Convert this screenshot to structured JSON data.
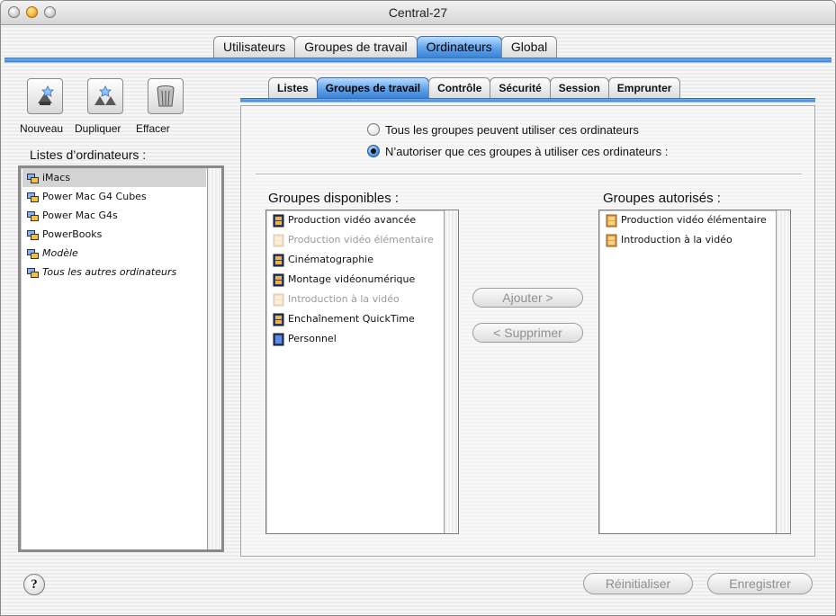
{
  "window": {
    "title": "Central-27"
  },
  "main_tabs": [
    {
      "label": "Utilisateurs",
      "active": false
    },
    {
      "label": "Groupes de travail",
      "active": false
    },
    {
      "label": "Ordinateurs",
      "active": true
    },
    {
      "label": "Global",
      "active": false
    }
  ],
  "toolbar": {
    "new_label": "Nouveau",
    "duplicate_label": "Dupliquer",
    "delete_label": "Effacer"
  },
  "computer_lists": {
    "label": "Listes d’ordinateurs :",
    "items": [
      {
        "label": "iMacs",
        "selected": true,
        "italic": false
      },
      {
        "label": "Power Mac G4 Cubes",
        "selected": false,
        "italic": false
      },
      {
        "label": "Power Mac G4s",
        "selected": false,
        "italic": false
      },
      {
        "label": "PowerBooks",
        "selected": false,
        "italic": false
      },
      {
        "label": "Modèle",
        "selected": false,
        "italic": true
      },
      {
        "label": "Tous les autres ordinateurs",
        "selected": false,
        "italic": true
      }
    ]
  },
  "sub_tabs": [
    {
      "label": "Listes",
      "active": false
    },
    {
      "label": "Groupes de travail",
      "active": true
    },
    {
      "label": "Contrôle",
      "active": false
    },
    {
      "label": "Sécurité",
      "active": false
    },
    {
      "label": "Session",
      "active": false
    },
    {
      "label": "Emprunter",
      "active": false
    }
  ],
  "options": {
    "all_groups_label": "Tous les groupes peuvent utiliser ces ordinateurs",
    "only_these_label": "N’autoriser que ces groupes à utiliser ces ordinateurs :",
    "selected": "only_these"
  },
  "available_groups": {
    "label": "Groupes disponibles :",
    "items": [
      {
        "label": "Production vidéo avancée",
        "dim": false,
        "icon": "workgroup-icon"
      },
      {
        "label": "Production vidéo élémentaire",
        "dim": true,
        "icon": "workgroup-icon"
      },
      {
        "label": "Cinématographie",
        "dim": false,
        "icon": "workgroup-icon"
      },
      {
        "label": "Montage vidéonumérique",
        "dim": false,
        "icon": "workgroup-icon"
      },
      {
        "label": "Introduction à la vidéo",
        "dim": true,
        "icon": "workgroup-icon"
      },
      {
        "label": "Enchaînement QuickTime",
        "dim": false,
        "icon": "workgroup-icon"
      },
      {
        "label": "Personnel",
        "dim": false,
        "icon": "workgroup-icon"
      }
    ]
  },
  "authorized_groups": {
    "label": "Groupes autorisés :",
    "items": [
      {
        "label": "Production vidéo élémentaire",
        "icon": "workgroup-icon"
      },
      {
        "label": "Introduction à la vidéo",
        "icon": "workgroup-icon"
      }
    ]
  },
  "buttons": {
    "add_label": "Ajouter >",
    "remove_label": "< Supprimer",
    "reset_label": "Réinitialiser",
    "save_label": "Enregistrer",
    "help_label": "?"
  },
  "colors": {
    "accent": "#4a90e2",
    "disabled_text": "#9a9a9a"
  }
}
